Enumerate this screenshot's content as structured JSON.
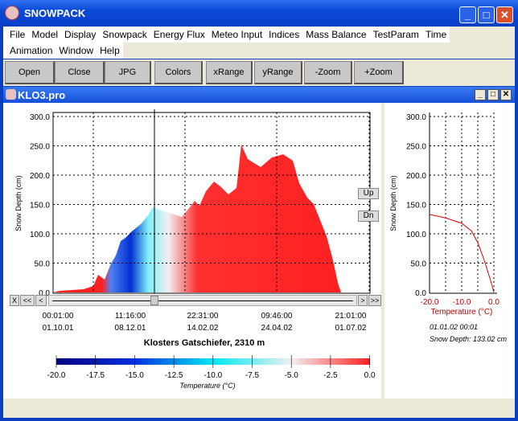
{
  "app": {
    "title": "SNOWPACK"
  },
  "menu": [
    "File",
    "Model",
    "Display",
    "Snowpack",
    "Energy Flux",
    "Meteo Input",
    "Indices",
    "Mass Balance",
    "TestParam",
    "Time"
  ],
  "menu2": [
    "Animation",
    "Window",
    "Help"
  ],
  "toolbar": [
    "Open",
    "Close",
    "JPG",
    "Colors",
    "xRange",
    "yRange",
    "-Zoom",
    "+Zoom"
  ],
  "inner": {
    "title": "KLO3.pro"
  },
  "main": {
    "ylabel": "Snow Depth (cm)",
    "yticks": [
      "0.0",
      "50.0",
      "100.0",
      "150.0",
      "200.0",
      "250.0",
      "300.0"
    ],
    "xticks_time": [
      "00:01:00",
      "11:16:00",
      "22:31:00",
      "09:46:00",
      "21:01:00"
    ],
    "xticks_date": [
      "01.10.01",
      "08.12.01",
      "14.02.02",
      "24.04.02",
      "01.07.02"
    ],
    "station": "Klosters Gatschiefer, 2310 m",
    "up": "Up",
    "dn": "Dn",
    "scroll": {
      "x": "X",
      "first": "<<",
      "prev": "<",
      "next": ">",
      "last": ">>"
    },
    "colorbar": {
      "ticks": [
        "-20.0",
        "-17.5",
        "-15.0",
        "-12.5",
        "-10.0",
        "-7.5",
        "-5.0",
        "-2.5",
        "0.0"
      ],
      "label": "Temperature (°C)",
      "colors": [
        "#000080",
        "#0030e0",
        "#00e8f0",
        "#f0f0f0",
        "#ff2020"
      ]
    }
  },
  "profile": {
    "ylabel": "Snow Depth (cm)",
    "yticks": [
      "0.0",
      "50.0",
      "100.0",
      "150.0",
      "200.0",
      "250.0",
      "300.0"
    ],
    "xticks": [
      "-20.0",
      "-10.0",
      "0.0"
    ],
    "xlabel": "Temperature (°C)",
    "date": "01.01.02 00:01",
    "depth": "Snow Depth: 133.02 cm",
    "chart_data": {
      "type": "line",
      "x": [
        -20,
        -15,
        -10,
        -7,
        -5,
        -3,
        -1,
        0
      ],
      "y": [
        133,
        127,
        118,
        105,
        85,
        55,
        20,
        0
      ],
      "xlim": [
        -20,
        0
      ],
      "ylim": [
        0,
        300
      ],
      "color": "#e00000"
    }
  }
}
